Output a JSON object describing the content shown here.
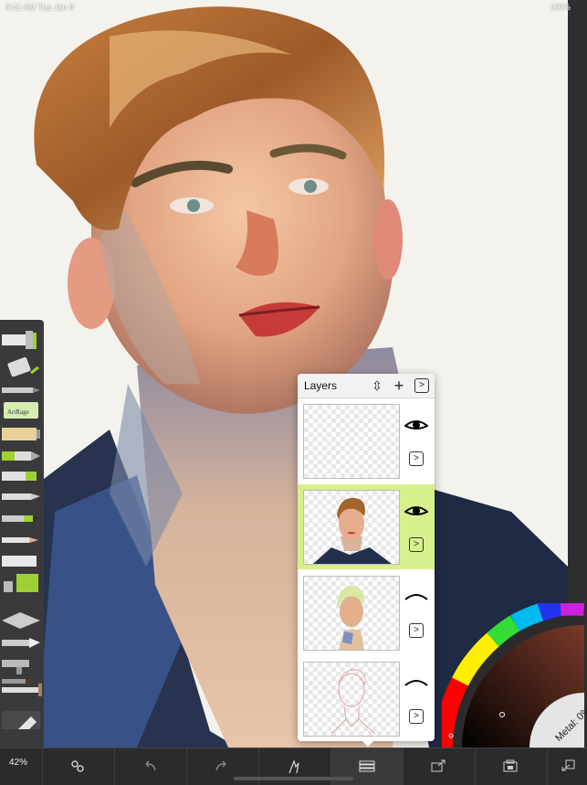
{
  "app": "ArtRage",
  "status_bar": {
    "left": "9:41 AM  Tue Jan 9",
    "right": "100%"
  },
  "tool_palette": {
    "items": [
      "paint-roller-icon",
      "glitter-tube-icon",
      "airbrush-icon",
      "sticker-icon",
      "paint-tube-icon",
      "marker-icon",
      "pencil-icon",
      "ink-pen-icon",
      "crayon-icon",
      "chalk-icon",
      "palette-knife-icon",
      "paint-bucket-icon",
      "eraser-icon",
      "gloop-pen-icon",
      "airbrush-gun-icon",
      "watercolor-icon",
      "oil-brush-icon",
      "selected-brush-icon"
    ],
    "sticker_label": "ArtRage"
  },
  "layers_panel": {
    "title": "Layers",
    "reorder_label": "⇳",
    "add_label": "+",
    "options_label": ">",
    "layers": [
      {
        "visible": true,
        "selected": false,
        "more_label": ">"
      },
      {
        "visible": true,
        "selected": true,
        "more_label": ">"
      },
      {
        "visible": false,
        "selected": false,
        "more_label": ">"
      },
      {
        "visible": false,
        "selected": false,
        "more_label": ">"
      }
    ]
  },
  "color_picker": {
    "metal_label": "Metal: 0%"
  },
  "toolbar": {
    "zoom": "42%",
    "buttons": [
      "settings-icon",
      "undo-icon",
      "redo-icon",
      "reference-icon",
      "layers-icon",
      "share-icon",
      "gallery-icon",
      "back-icon"
    ]
  }
}
